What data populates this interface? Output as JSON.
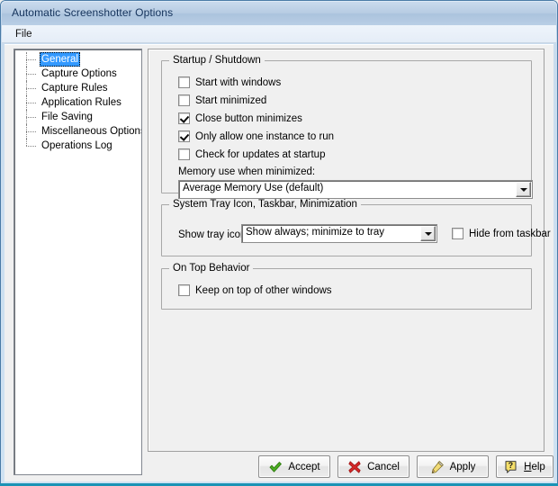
{
  "window": {
    "title": "Automatic Screenshotter Options"
  },
  "menubar": {
    "items": [
      {
        "label": "File"
      }
    ]
  },
  "sidebar": {
    "items": [
      {
        "label": "General",
        "selected": true
      },
      {
        "label": "Capture Options",
        "selected": false
      },
      {
        "label": "Capture Rules",
        "selected": false
      },
      {
        "label": "Application Rules",
        "selected": false
      },
      {
        "label": "File Saving",
        "selected": false
      },
      {
        "label": "Miscellaneous Options",
        "selected": false
      },
      {
        "label": "Operations Log",
        "selected": false
      }
    ]
  },
  "main": {
    "startup_group": {
      "title": "Startup / Shutdown",
      "checkboxes": [
        {
          "label": "Start with windows",
          "checked": false
        },
        {
          "label": "Start minimized",
          "checked": false
        },
        {
          "label": "Close button minimizes",
          "checked": true
        },
        {
          "label": "Only allow one instance to run",
          "checked": true
        },
        {
          "label": "Check for updates at startup",
          "checked": false
        }
      ],
      "memory_label": "Memory use when minimized:",
      "memory_value": "Average Memory Use (default)"
    },
    "tray_group": {
      "title": "System Tray Icon, Taskbar, Minimization",
      "tray_label": "Show tray icon:",
      "tray_value": "Show always; minimize to tray",
      "hide_taskbar_label": "Hide from taskbar",
      "hide_taskbar_checked": false
    },
    "ontop_group": {
      "title": "On Top Behavior",
      "keep_on_top_label": "Keep on top of other windows",
      "keep_on_top_checked": false
    }
  },
  "footer": {
    "accept_label": "Accept",
    "cancel_label": "Cancel",
    "apply_label": "Apply",
    "help_label_prefix": "H",
    "help_label_rest": "elp"
  },
  "colors": {
    "selection": "#3399ff",
    "accept_icon": "#4caf22",
    "cancel_icon": "#d62828",
    "apply_icon": "#e8c84a",
    "help_icon": "#f2d64b",
    "titlebar": "#b7cce3"
  }
}
